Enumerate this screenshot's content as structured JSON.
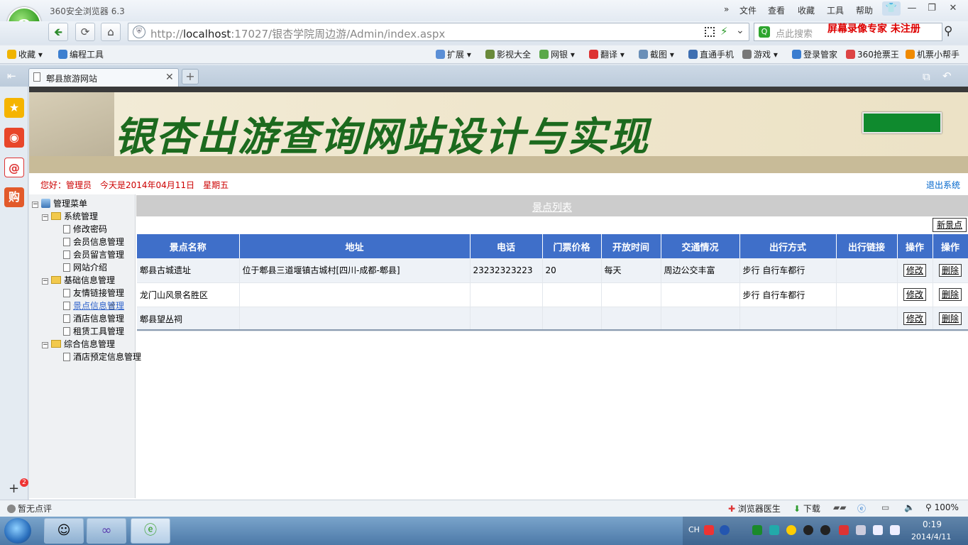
{
  "browser": {
    "app_title": "360安全浏览器 6.3",
    "menu": [
      "文件",
      "查看",
      "收藏",
      "工具",
      "帮助"
    ],
    "address_prefix": "http://",
    "address_host": "localhost",
    "address_rest": ":17027/银杏学院周边游/Admin/index.aspx",
    "search_placeholder": "点此搜索",
    "recorder_watermark": "屏幕录像专家 未注册",
    "bookmarks_left": [
      {
        "label": "收藏",
        "color": "#f0b400"
      },
      {
        "label": "编程工具",
        "color": "#3d7fd0"
      }
    ],
    "bookmarks_right": [
      {
        "label": "扩展",
        "color": "#5b8fd6"
      },
      {
        "label": "影视大全",
        "color": "#6a8a3a"
      },
      {
        "label": "网银",
        "color": "#5aa84a"
      },
      {
        "label": "翻译",
        "color": "#d33"
      },
      {
        "label": "截图",
        "color": "#6a8fb8"
      },
      {
        "label": "直通手机",
        "color": "#3e6fb2"
      },
      {
        "label": "游戏",
        "color": "#777"
      },
      {
        "label": "登录管家",
        "color": "#3a7dd0"
      },
      {
        "label": "360抢票王",
        "color": "#d44"
      },
      {
        "label": "机票小帮手",
        "color": "#f08a00"
      }
    ],
    "tab_label": "郫县旅游网站",
    "status_left": "暂无点评",
    "status_doctor": "浏览器医生",
    "status_download": "下载",
    "status_zoom": "100%",
    "sidebar_badge": "2"
  },
  "site": {
    "banner_title": "银杏出游查询网站设计与实现",
    "welcome": "您好：管理员　今天是2014年04月11日　星期五",
    "logout": "退出系统"
  },
  "tree": {
    "root": "管理菜单",
    "groups": [
      {
        "label": "系统管理",
        "items": [
          "修改密码",
          "会员信息管理",
          "会员留言管理",
          "网站介绍"
        ]
      },
      {
        "label": "基础信息管理",
        "items": [
          "友情链接管理",
          "景点信息管理",
          "酒店信息管理",
          "租赁工具管理"
        ]
      },
      {
        "label": "综合信息管理",
        "items": [
          "酒店预定信息管理"
        ]
      }
    ]
  },
  "list": {
    "title": "景点列表",
    "add_label": "新景点",
    "columns": [
      "景点名称",
      "地址",
      "电话",
      "门票价格",
      "开放时间",
      "交通情况",
      "出行方式",
      "出行链接",
      "操作",
      "操作"
    ],
    "edit_label": "修改",
    "delete_label": "删除",
    "rows": [
      [
        "郫县古城遗址",
        "位于郫县三道堰镇古城村[四川-成都-郫县]",
        "23232323223",
        "20",
        "每天",
        "周边公交丰富",
        "步行 自行车都行",
        ""
      ],
      [
        "龙门山风景名胜区",
        "",
        "",
        "",
        "",
        "",
        "步行 自行车都行",
        ""
      ],
      [
        "郫县望丛祠",
        "",
        "",
        "",
        "",
        "",
        "",
        ""
      ]
    ]
  },
  "taskbar": {
    "time": "0:19",
    "date": "2014/4/11",
    "ime": "CH"
  }
}
